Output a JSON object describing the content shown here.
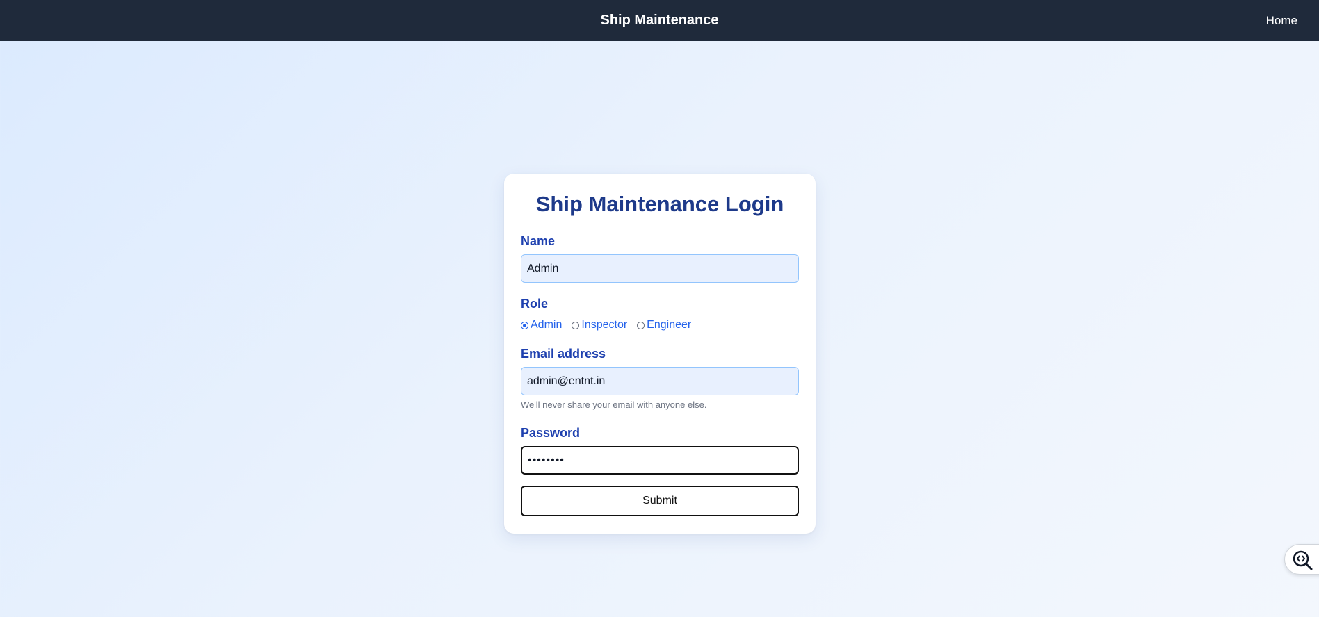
{
  "navbar": {
    "brand": "Ship Maintenance",
    "home_link": "Home"
  },
  "login": {
    "title": "Ship Maintenance Login",
    "name": {
      "label": "Name",
      "value": "Admin"
    },
    "role": {
      "label": "Role",
      "options": [
        "Admin",
        "Inspector",
        "Engineer"
      ],
      "selected": "Admin"
    },
    "email": {
      "label": "Email address",
      "value": "admin@entnt.in",
      "help": "We'll never share your email with anyone else."
    },
    "password": {
      "label": "Password",
      "value": "••••••••"
    },
    "submit_label": "Submit"
  },
  "icons": {
    "devtools": "code-inspect-icon"
  },
  "colors": {
    "navbar_bg": "#1f2a3b",
    "title": "#1e3a8a",
    "label": "#1e40af",
    "radio_text": "#2563eb",
    "input_bg": "#e8f0fe"
  }
}
